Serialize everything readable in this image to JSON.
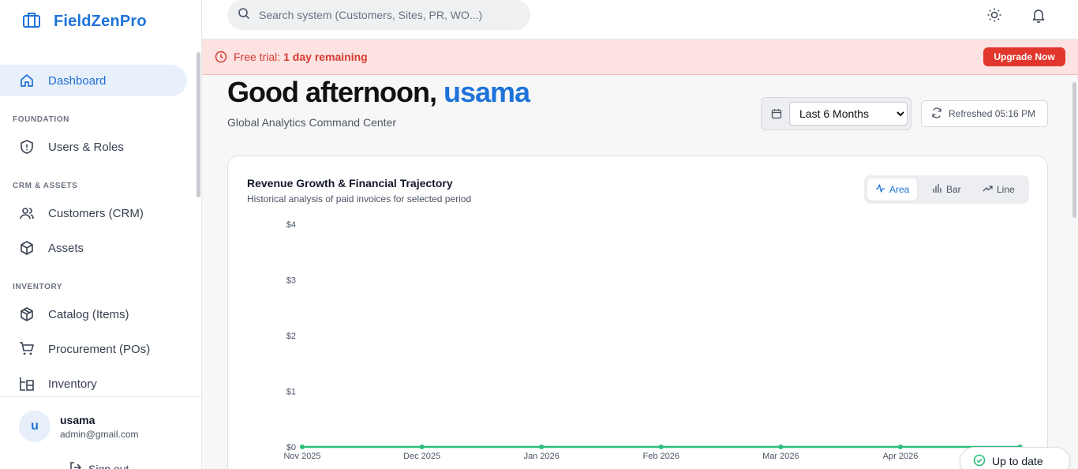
{
  "brand": {
    "name": "FieldZenPro"
  },
  "sidebar": {
    "items": [
      {
        "label": "Dashboard",
        "icon": "home-icon",
        "active": true
      },
      {
        "section": "FOUNDATION"
      },
      {
        "label": "Users & Roles",
        "icon": "shield-icon"
      },
      {
        "section": "CRM & ASSETS"
      },
      {
        "label": "Customers (CRM)",
        "icon": "users-icon"
      },
      {
        "label": "Assets",
        "icon": "box-icon"
      },
      {
        "section": "INVENTORY"
      },
      {
        "label": "Catalog (Items)",
        "icon": "package-icon"
      },
      {
        "label": "Procurement (POs)",
        "icon": "cart-icon"
      },
      {
        "label": "Inventory",
        "icon": "warehouse-icon"
      }
    ],
    "labels": {
      "dashboard": "Dashboard",
      "foundation": "FOUNDATION",
      "users_roles": "Users & Roles",
      "crm_assets": "CRM & ASSETS",
      "customers": "Customers (CRM)",
      "assets": "Assets",
      "inventory_section": "INVENTORY",
      "catalog": "Catalog (Items)",
      "procurement": "Procurement (POs)",
      "inventory": "Inventory"
    }
  },
  "user": {
    "initial": "u",
    "name": "usama",
    "email": "admin@gmail.com",
    "signout": "Sign out"
  },
  "search": {
    "placeholder": "Search system (Customers, Sites, PR, WO...)"
  },
  "banner": {
    "prefix": "Free trial:",
    "emphasis": "1 day remaining",
    "button": "Upgrade Now"
  },
  "header": {
    "greeting": "Good afternoon,",
    "user": "usama",
    "subtitle": "Global Analytics Command Center",
    "range_selected": "Last 6 Months",
    "refreshed": "Refreshed 05:16 PM"
  },
  "card": {
    "title": "Revenue Growth & Financial Trajectory",
    "subtitle": "Historical analysis of paid invoices for selected period",
    "modes": [
      "Area",
      "Bar",
      "Line"
    ],
    "active_mode": "Area"
  },
  "colors": {
    "accent": "#1e73d9",
    "series": "#2bbf7a",
    "danger": "#e0362c"
  },
  "chart_data": {
    "type": "area",
    "categories": [
      "Nov 2025",
      "Dec 2025",
      "Jan 2026",
      "Feb 2026",
      "Mar 2026",
      "Apr 2026",
      ""
    ],
    "x_tick_labels": [
      "Nov 2025",
      "Dec 2025",
      "Jan 2026",
      "Feb 2026",
      "Mar 2026",
      "Apr 2026"
    ],
    "series": [
      {
        "values": [
          0,
          0,
          0,
          0,
          0,
          0,
          0
        ]
      }
    ],
    "y_tick_labels": [
      "$0",
      "$1",
      "$2",
      "$3",
      "$4"
    ],
    "y_ticks": [
      0,
      1,
      2,
      3,
      4
    ],
    "ylim": [
      0,
      4
    ],
    "grid": false
  },
  "toast": {
    "text": "Up to date"
  }
}
